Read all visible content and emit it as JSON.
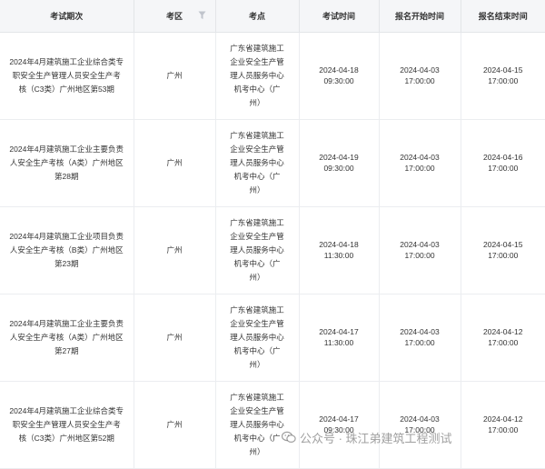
{
  "table": {
    "columns": [
      {
        "key": "session",
        "label": "考试期次"
      },
      {
        "key": "area",
        "label": "考区"
      },
      {
        "key": "venue",
        "label": "考点"
      },
      {
        "key": "exam_time",
        "label": "考试时间"
      },
      {
        "key": "reg_start",
        "label": "报名开始时间"
      },
      {
        "key": "reg_end",
        "label": "报名结束时间"
      }
    ],
    "filter_icon": "filter-icon",
    "rows": [
      {
        "session": "2024年4月建筑施工企业综合类专职安全生产管理人员安全生产考核（C3类）广州地区第53期",
        "area": "广州",
        "venue": "广东省建筑施工企业安全生产管理人员服务中心机考中心（广州）",
        "exam_date": "2024-04-18",
        "exam_time": "09:30:00",
        "reg_start_date": "2024-04-03",
        "reg_start_time": "17:00:00",
        "reg_end_date": "2024-04-15",
        "reg_end_time": "17:00:00"
      },
      {
        "session": "2024年4月建筑施工企业主要负责人安全生产考核（A类）广州地区第28期",
        "area": "广州",
        "venue": "广东省建筑施工企业安全生产管理人员服务中心机考中心（广州）",
        "exam_date": "2024-04-19",
        "exam_time": "09:30:00",
        "reg_start_date": "2024-04-03",
        "reg_start_time": "17:00:00",
        "reg_end_date": "2024-04-16",
        "reg_end_time": "17:00:00"
      },
      {
        "session": "2024年4月建筑施工企业项目负责人安全生产考核（B类）广州地区第23期",
        "area": "广州",
        "venue": "广东省建筑施工企业安全生产管理人员服务中心机考中心（广州）",
        "exam_date": "2024-04-18",
        "exam_time": "11:30:00",
        "reg_start_date": "2024-04-03",
        "reg_start_time": "17:00:00",
        "reg_end_date": "2024-04-15",
        "reg_end_time": "17:00:00"
      },
      {
        "session": "2024年4月建筑施工企业主要负责人安全生产考核（A类）广州地区第27期",
        "area": "广州",
        "venue": "广东省建筑施工企业安全生产管理人员服务中心机考中心（广州）",
        "exam_date": "2024-04-17",
        "exam_time": "11:30:00",
        "reg_start_date": "2024-04-03",
        "reg_start_time": "17:00:00",
        "reg_end_date": "2024-04-12",
        "reg_end_time": "17:00:00"
      },
      {
        "session": "2024年4月建筑施工企业综合类专职安全生产管理人员安全生产考核（C3类）广州地区第52期",
        "area": "广州",
        "venue": "广东省建筑施工企业安全生产管理人员服务中心机考中心（广州）",
        "exam_date": "2024-04-17",
        "exam_time": "09:30:00",
        "reg_start_date": "2024-04-03",
        "reg_start_time": "17:00:00",
        "reg_end_date": "2024-04-12",
        "reg_end_time": "17:00:00"
      }
    ]
  },
  "watermark": {
    "icon": "wechat-icon",
    "text": "公众号 · 珠江弟建筑工程测试"
  }
}
